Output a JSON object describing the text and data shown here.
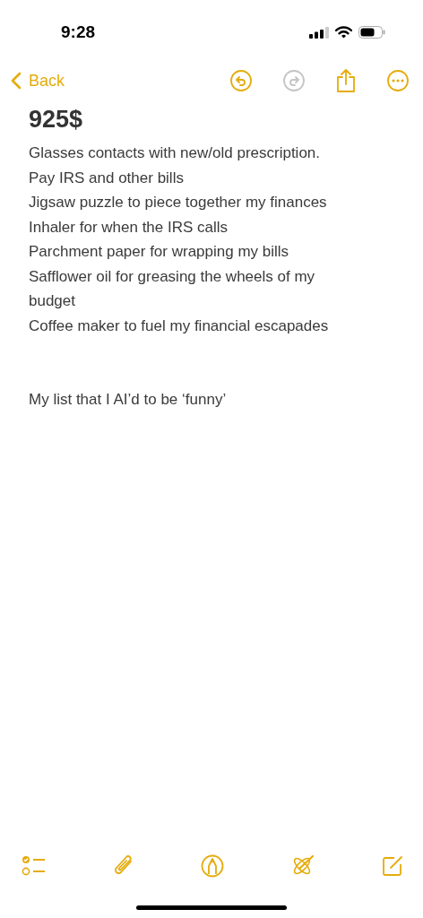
{
  "status_bar": {
    "time": "9:28"
  },
  "nav": {
    "back": "Back",
    "undo_disabled": false,
    "redo_disabled": true
  },
  "note": {
    "title": "925$",
    "lines": [
      "Glasses contacts with new/old prescription.",
      "Pay IRS and other bills",
      "Jigsaw puzzle to piece together my finances",
      "Inhaler for when the IRS calls",
      "Parchment paper for wrapping my bills",
      "Safflower oil for greasing the wheels of my budget",
      "Coffee maker to fuel my financial escapades"
    ],
    "footer": "My list that I AI’d to be ‘funny’"
  }
}
